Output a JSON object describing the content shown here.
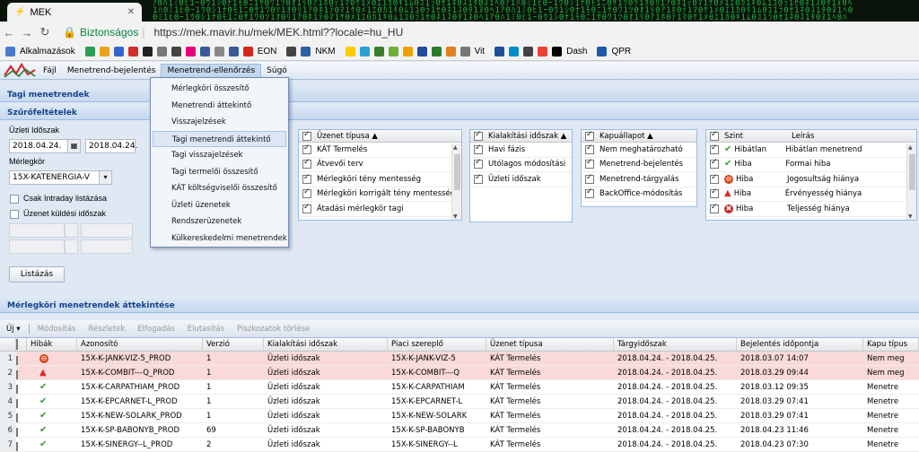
{
  "browser": {
    "tab_title": "MEK",
    "secure_label": "Biztonságos",
    "url": "https://mek.mavir.hu/mek/MEK.html??locale=hu_HU",
    "bookmarks": [
      {
        "label": "Alkalmazások",
        "color": "#4a7bd0"
      },
      {
        "label": "",
        "color": "#2a9d56"
      },
      {
        "label": "",
        "color": "#e8a21c"
      },
      {
        "label": "",
        "color": "#3366cc"
      },
      {
        "label": "",
        "color": "#d32f2f"
      },
      {
        "label": "",
        "color": "#222222"
      },
      {
        "label": "",
        "color": "#777777"
      },
      {
        "label": "",
        "color": "#444444"
      },
      {
        "label": "",
        "color": "#e6007e"
      },
      {
        "label": "",
        "color": "#3b5998"
      },
      {
        "label": "",
        "color": "#888888"
      },
      {
        "label": "",
        "color": "#3b5998"
      },
      {
        "label": "EON",
        "color": "#d8261c"
      },
      {
        "label": "",
        "color": "#444444"
      },
      {
        "label": "NKM",
        "color": "#2b5fa6"
      },
      {
        "label": "",
        "color": "#ffcc00"
      },
      {
        "label": "",
        "color": "#2b9fd4"
      },
      {
        "label": "",
        "color": "#3a7d2c"
      },
      {
        "label": "",
        "color": "#6cae3a"
      },
      {
        "label": "",
        "color": "#f0a000"
      },
      {
        "label": "",
        "color": "#1f4e9c"
      },
      {
        "label": "",
        "color": "#2c7a2c"
      },
      {
        "label": "",
        "color": "#e08020"
      },
      {
        "label": "Vit",
        "color": "#777777"
      },
      {
        "label": "",
        "color": "#1f4e9c"
      },
      {
        "label": "",
        "color": "#008cc9"
      },
      {
        "label": "",
        "color": "#444444"
      },
      {
        "label": "",
        "color": "#ea4335"
      },
      {
        "label": "Dash",
        "color": "#000000"
      },
      {
        "label": "QPR",
        "color": "#1a5aa8"
      }
    ]
  },
  "menubar": {
    "items": [
      "Fájl",
      "Menetrend-bejelentés",
      "Menetrend-ellenőrzés",
      "Súgó"
    ]
  },
  "dropdown": {
    "items": [
      "Mérlegköri összesítő",
      "Menetrendi áttekintő",
      "Visszajelzések",
      "Tagi menetrendi áttekintő",
      "Tagi visszajelzések",
      "Tagi termelői összesítő",
      "KÁT költségviselői összesítő",
      "Üzleti üzenetek",
      "Rendszerüzenetek",
      "Külkereskedelmi menetrendek"
    ],
    "highlighted": "Tagi menetrendi áttekintő"
  },
  "panels": {
    "tagi": "Tagi menetrendek",
    "szuro": "Szűrőfeltételek",
    "merleg": "Mérlegköri menetrendek áttekintése"
  },
  "filters": {
    "uzleti_label": "Üzleti Időszak",
    "date_from": "2018.04.24.",
    "date_to": "2018.04.24.",
    "merlegkor_label": "Mérlegkör",
    "merlegkor_value": "15X-KATENERGIA-V",
    "intraday": "Csak Intraday listázása",
    "uzenet_kuldesi": "Üzenet küldési időszak",
    "list_button": "Listázás"
  },
  "grids": {
    "uzenet": {
      "header": "Üzenet típusa ▲",
      "rows": [
        "KÁT Termelés",
        "Átvevői terv",
        "Mérlegköri tény mentesség",
        "Mérlegköri korrigált tény mentesség",
        "Átadási mérlegkör tagi"
      ]
    },
    "kialakitasi": {
      "header": "Kialakítási időszak ▲",
      "rows": [
        "Havi fázis",
        "Utólagos módosítási",
        "Üzleti időszak"
      ]
    },
    "kapu": {
      "header": "Kapuállapot ▲",
      "rows": [
        "Nem meghatározható",
        "Menetrend-bejelentés",
        "Menetrend-tárgyalás",
        "BackOffice-módosítás"
      ]
    },
    "szint": {
      "h1": "Szint",
      "h2": "Leírás",
      "rows": [
        {
          "szint": "Hibátlan",
          "leiras": "Hibátlan menetrend",
          "icon": "check"
        },
        {
          "szint": "Hiba",
          "leiras": "Formai hiba",
          "icon": "check"
        },
        {
          "szint": "Hiba",
          "leiras": "Jogosultság hiánya",
          "icon": "noentry"
        },
        {
          "szint": "Hiba",
          "leiras": "Érvényesség hiánya",
          "icon": "warn"
        },
        {
          "szint": "Hiba",
          "leiras": "Teljesség hiánya",
          "icon": "stop"
        }
      ]
    }
  },
  "toolbar": [
    "Új ▾",
    "Módosítás",
    "Részletek",
    "Elfogadás",
    "Elutasítás",
    "Piszkozatok törlése"
  ],
  "main_grid": {
    "headers": [
      "",
      "",
      "Hibák",
      "Azonosító",
      "Verzió",
      "Kialakítási időszak",
      "Piaci szereplő",
      "Üzenet típusa",
      "Tárgyidőszak",
      "Bejelentés időpontja",
      "Kapu típus"
    ],
    "rows": [
      {
        "n": "1",
        "icon": "noentry",
        "id": "15X-K-JANK-VIZ-5_PROD",
        "ver": "1",
        "kial": "Üzleti időszak",
        "piaci": "15X-K-JANK-VIZ-5",
        "tip": "KÁT Termelés",
        "targy": "2018.04.24. - 2018.04.25.",
        "bej": "2018.03.07 14:07",
        "kapu": "Nem meg",
        "err": true
      },
      {
        "n": "2",
        "icon": "warn",
        "id": "15X-K-COMBIT---Q_PROD",
        "ver": "1",
        "kial": "Üzleti időszak",
        "piaci": "15X-K-COMBIT---Q",
        "tip": "KÁT Termelés",
        "targy": "2018.04.24. - 2018.04.25.",
        "bej": "2018.03.29 09:44",
        "kapu": "Nem meg",
        "err": true
      },
      {
        "n": "3",
        "icon": "check",
        "id": "15X-K-CARPATHIAM_PROD",
        "ver": "1",
        "kial": "Üzleti időszak",
        "piaci": "15X-K-CARPATHIAM",
        "tip": "KÁT Termelés",
        "targy": "2018.04.24. - 2018.04.25.",
        "bej": "2018.03.12 09:35",
        "kapu": "Menetre",
        "err": false
      },
      {
        "n": "4",
        "icon": "check",
        "id": "15X-K-EPCARNET-L_PROD",
        "ver": "1",
        "kial": "Üzleti időszak",
        "piaci": "15X-K-EPCARNET-L",
        "tip": "KÁT Termelés",
        "targy": "2018.04.24. - 2018.04.25.",
        "bej": "2018.03.29 07:41",
        "kapu": "Menetre",
        "err": false
      },
      {
        "n": "5",
        "icon": "check",
        "id": "15X-K-NEW-SOLARK_PROD",
        "ver": "1",
        "kial": "Üzleti időszak",
        "piaci": "15X-K-NEW-SOLARK",
        "tip": "KÁT Termelés",
        "targy": "2018.04.24. - 2018.04.25.",
        "bej": "2018.03.29 07:41",
        "kapu": "Menetre",
        "err": false
      },
      {
        "n": "6",
        "icon": "check",
        "id": "15X-K-SP-BABONYB_PROD",
        "ver": "69",
        "kial": "Üzleti időszak",
        "piaci": "15X-K-SP-BABONYB",
        "tip": "KÁT Termelés",
        "targy": "2018.04.24. - 2018.04.25.",
        "bej": "2018.04.23 11:46",
        "kapu": "Menetre",
        "err": false
      },
      {
        "n": "7",
        "icon": "check",
        "id": "15X-K-SINERGY--L_PROD",
        "ver": "2",
        "kial": "Üzleti időszak",
        "piaci": "15X-K-SINERGY--L",
        "tip": "KÁT Termelés",
        "targy": "2018.04.24. - 2018.04.25.",
        "bej": "2018.04.23 07:30",
        "kapu": "Menetre",
        "err": false
      }
    ]
  }
}
